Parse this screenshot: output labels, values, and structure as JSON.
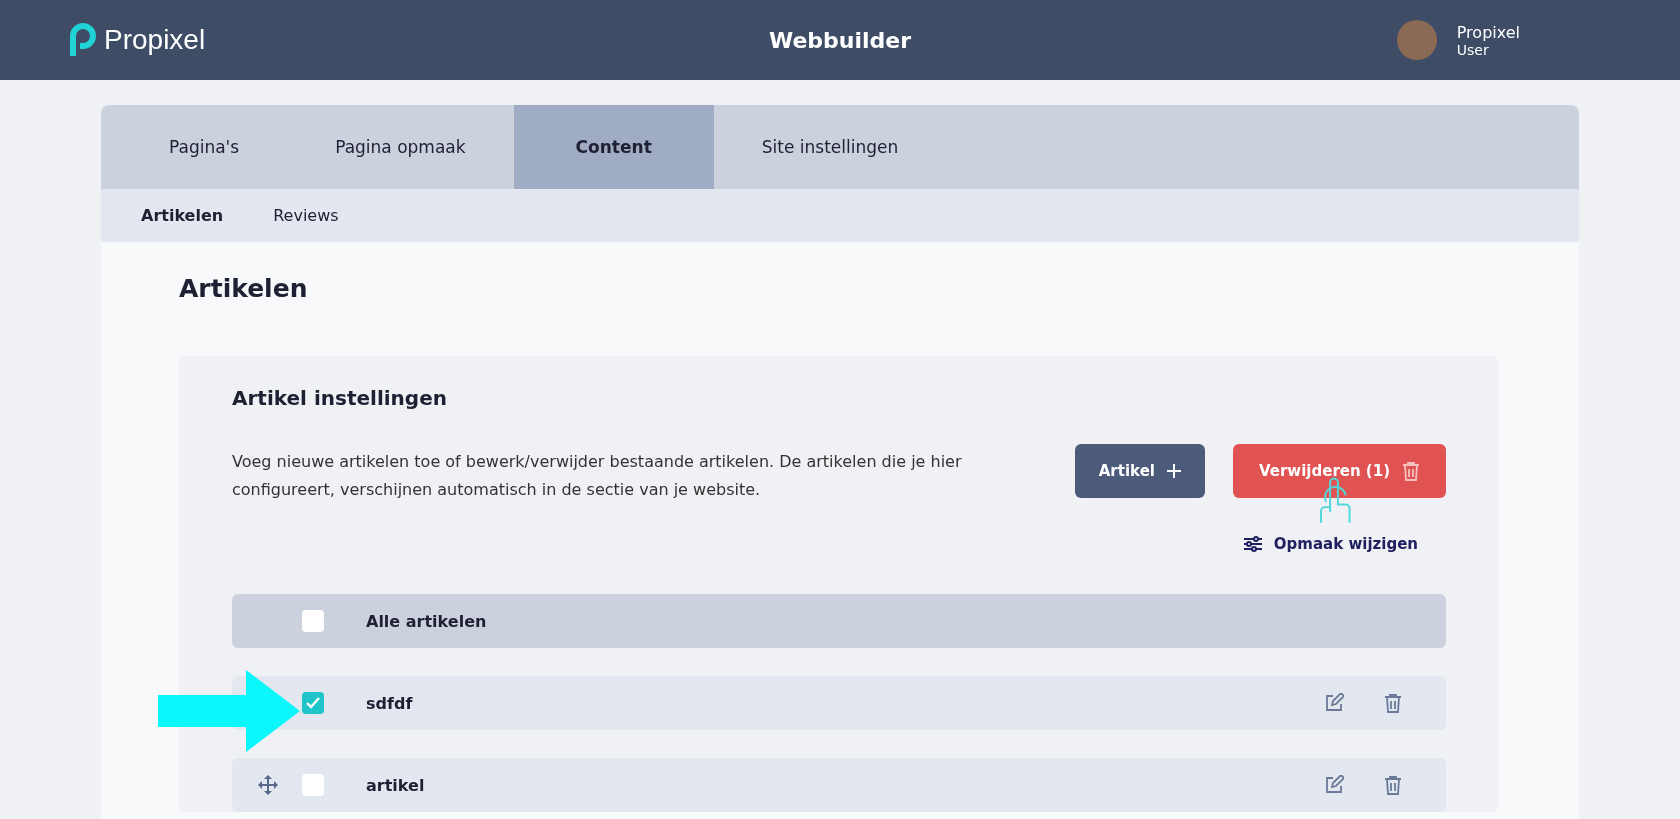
{
  "header": {
    "logo": "Propixel",
    "title": "Webbuilder",
    "user": {
      "name": "Propixel",
      "role": "User"
    }
  },
  "tabs": [
    {
      "label": "Pagina's",
      "selected": false
    },
    {
      "label": "Pagina opmaak",
      "selected": false
    },
    {
      "label": "Content",
      "selected": true
    },
    {
      "label": "Site instellingen",
      "selected": false
    }
  ],
  "subtabs": [
    {
      "label": "Artikelen",
      "selected": true
    },
    {
      "label": "Reviews",
      "selected": false
    }
  ],
  "heading": "Artikelen",
  "card": {
    "title": "Artikel instellingen",
    "description": "Voeg nieuwe artikelen toe of bewerk/verwijder bestaande artikelen. De artikelen die je hier configureert, verschijnen automatisch in de sectie van je website.",
    "add_button": "Artikel",
    "delete_button": "Verwijderen (1)",
    "layout_link": "Opmaak wijzigen"
  },
  "list": {
    "header": {
      "label": "Alle artikelen",
      "checked": false
    },
    "rows": [
      {
        "title": "sdfdf",
        "checked": true
      },
      {
        "title": "artikel",
        "checked": false
      }
    ]
  }
}
